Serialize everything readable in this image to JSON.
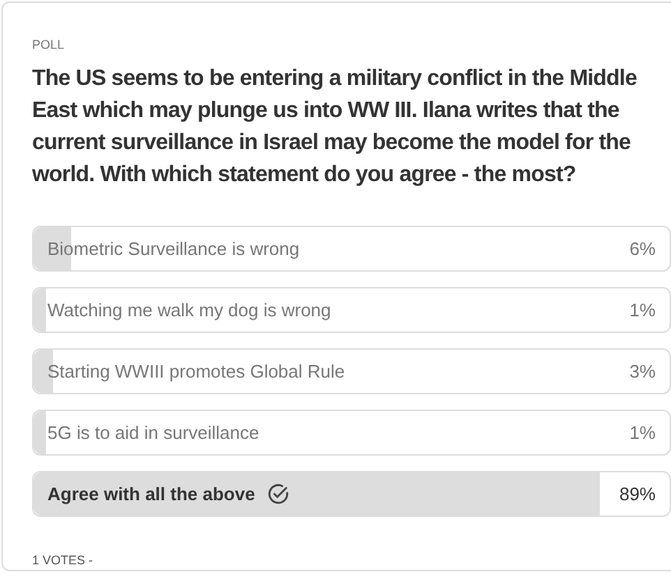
{
  "label": "POLL",
  "question": "The US seems to be entering a military conflict in the Middle East which may plunge us into WW III. Ilana writes that the current surveillance in Israel may become the model for the world. With which statement do you agree - the most?",
  "options": [
    {
      "text": "Biometric Surveillance is wrong",
      "percent": "6%",
      "level": 0.06,
      "selected": false
    },
    {
      "text": "Watching me walk my dog is wrong",
      "percent": "1%",
      "level": 0.01,
      "selected": false
    },
    {
      "text": "Starting WWIII promotes Global Rule",
      "percent": "3%",
      "level": 0.03,
      "selected": false
    },
    {
      "text": "5G is to aid in surveillance",
      "percent": "1%",
      "level": 0.01,
      "selected": false
    },
    {
      "text": "Agree with all the above",
      "percent": "89%",
      "level": 0.89,
      "selected": true
    }
  ],
  "votes": "1 VOTES -"
}
